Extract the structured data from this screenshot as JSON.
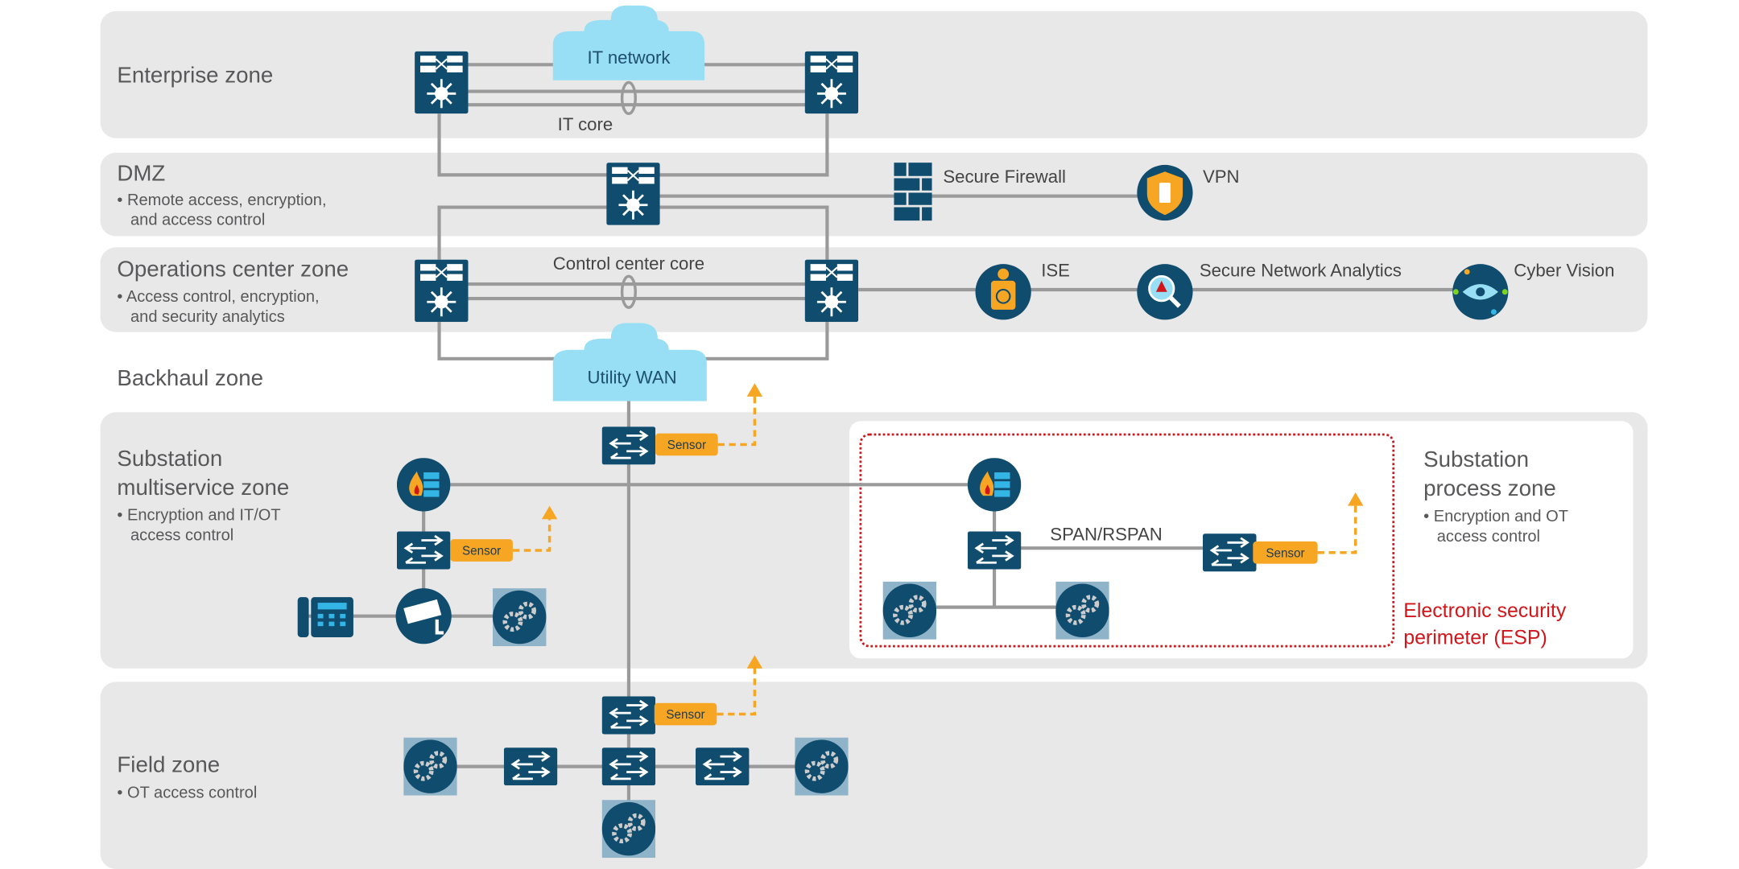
{
  "colors": {
    "zone": "#e8e8e8",
    "device": "#0f4c6e",
    "cloud": "#98dff5",
    "line": "#9a9a9a",
    "sensor": "#f6a623",
    "esp": "#d0161a"
  },
  "zones": {
    "enterprise": {
      "title": "Enterprise zone"
    },
    "dmz": {
      "title": "DMZ",
      "bullets": [
        "• Remote access, encryption,",
        "and access control"
      ]
    },
    "ops": {
      "title": "Operations center zone",
      "bullets": [
        "• Access control, encryption,",
        "and security analytics"
      ]
    },
    "backhaul": {
      "title": "Backhaul zone"
    },
    "multiservice": {
      "title": [
        "Substation",
        "multiservice zone"
      ],
      "bullets": [
        "• Encryption and IT/OT",
        "access control"
      ]
    },
    "process": {
      "title": [
        "Substation",
        "process zone"
      ],
      "bullets": [
        "• Encryption and OT",
        "access control"
      ]
    },
    "field": {
      "title": "Field zone",
      "bullets": [
        "• OT access control"
      ]
    }
  },
  "labels": {
    "it_network": "IT network",
    "it_core": "IT core",
    "control_core": "Control center core",
    "utility_wan": "Utility WAN",
    "firewall": "Secure Firewall",
    "vpn": "VPN",
    "ise": "ISE",
    "sna": "Secure Network Analytics",
    "cyber_vision": "Cyber Vision",
    "span": "SPAN/RSPAN",
    "sensor": "Sensor",
    "esp": [
      "Electronic security",
      "perimeter (ESP)"
    ]
  }
}
